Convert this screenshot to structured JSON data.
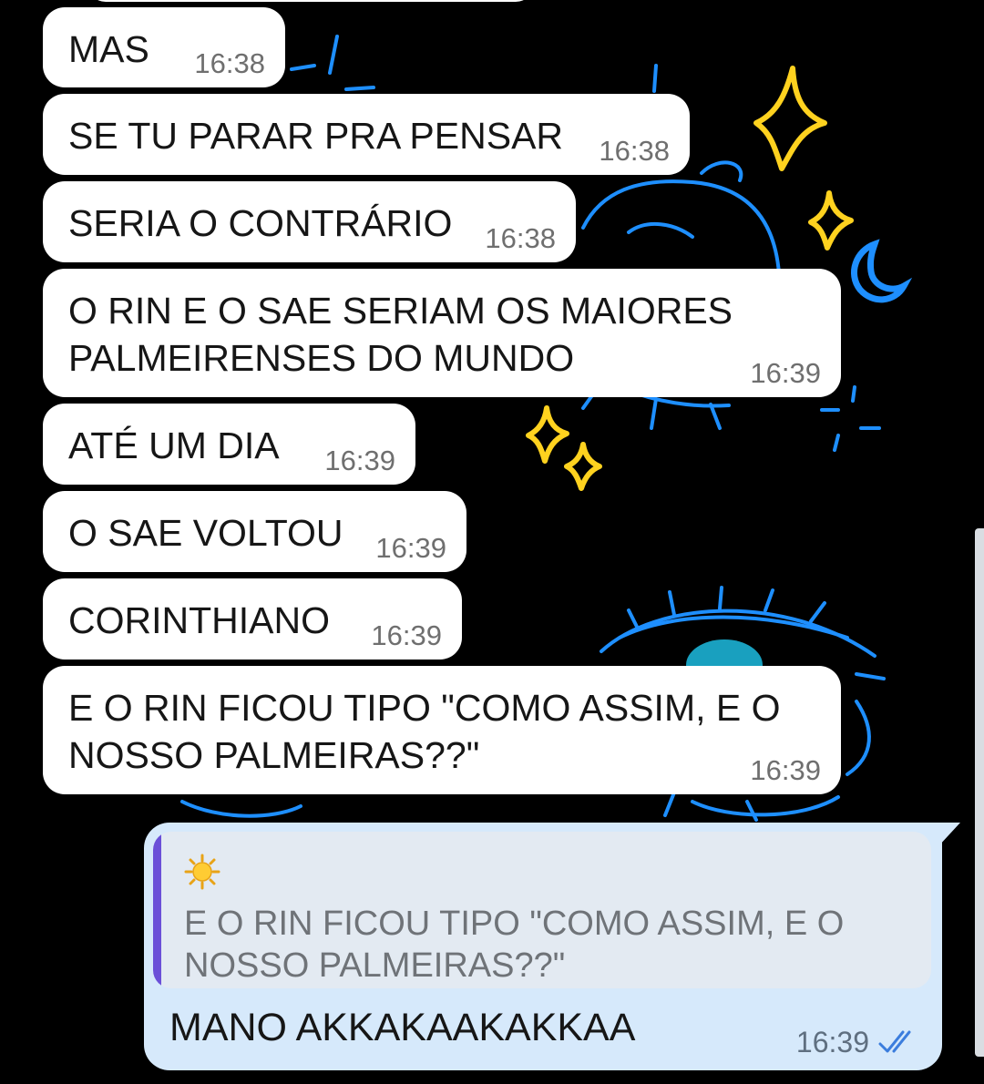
{
  "chat": {
    "incoming": [
      {
        "text": "MAS",
        "time": "16:38"
      },
      {
        "text": "SE TU PARAR PRA PENSAR",
        "time": "16:38"
      },
      {
        "text": "SERIA O CONTRÁRIO",
        "time": "16:38"
      },
      {
        "text": "O RIN E O SAE SERIAM OS MAIORES\nPALMEIRENSES DO MUNDO",
        "time": "16:39"
      },
      {
        "text": "ATÉ UM DIA",
        "time": "16:39"
      },
      {
        "text": "O SAE VOLTOU",
        "time": "16:39"
      },
      {
        "text": "CORINTHIANO",
        "time": "16:39"
      },
      {
        "text": "E O RIN FICOU TIPO \"COMO ASSIM, E O\nNOSSO PALMEIRAS??\"",
        "time": "16:39"
      }
    ],
    "outgoing": {
      "reply_author_icon": "sun-emoji",
      "quoted_text": "E O RIN FICOU TIPO \"COMO ASSIM, E O\nNOSSO PALMEIRAS??\"",
      "text": "MANO AKKAKAAKAKKAA",
      "time": "16:39",
      "status_icon": "double-check-read-icon"
    }
  },
  "colors": {
    "background": "#000000",
    "incoming_bubble": "#ffffff",
    "outgoing_bubble": "#d6e9fb",
    "quote_bar": "#6a4fd8",
    "wallpaper_blue": "#1e8fff",
    "wallpaper_yellow": "#ffd21f",
    "read_check": "#3b7ddd"
  }
}
